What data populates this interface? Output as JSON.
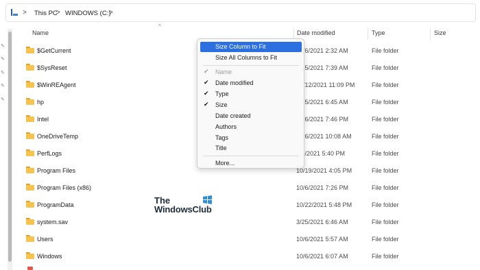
{
  "address_bar": {
    "segments": [
      "This PC",
      "WINDOWS (C:)"
    ],
    "separator": ">",
    "icon": "monitor-icon"
  },
  "columns": {
    "name": "Name",
    "date_modified": "Date modified",
    "type": "Type",
    "size": "Size",
    "sort_indicator": "^"
  },
  "files": [
    {
      "name": "$GetCurrent",
      "date": "10/6/2021 2:32 AM",
      "type": "File folder"
    },
    {
      "name": "$SysReset",
      "date": "3/25/2021 7:39 AM",
      "type": "File folder"
    },
    {
      "name": "$WinREAgent",
      "date": "10/12/2021 11:09 PM",
      "type": "File folder"
    },
    {
      "name": "hp",
      "date": "3/25/2021 6:45 AM",
      "type": "File folder"
    },
    {
      "name": "Intel",
      "date": "3/26/2021 7:46 PM",
      "type": "File folder"
    },
    {
      "name": "OneDriveTemp",
      "date": "3/26/2021 10:08 AM",
      "type": "File folder"
    },
    {
      "name": "PerfLogs",
      "date": "6/5/2021 5:40 PM",
      "type": "File folder"
    },
    {
      "name": "Program Files",
      "date": "10/19/2021 4:05 PM",
      "type": "File folder"
    },
    {
      "name": "Program Files (x86)",
      "date": "10/6/2021 7:26 PM",
      "type": "File folder"
    },
    {
      "name": "ProgramData",
      "date": "10/22/2021 5:48 PM",
      "type": "File folder"
    },
    {
      "name": "system.sav",
      "date": "3/25/2021 6:46 AM",
      "type": "File folder"
    },
    {
      "name": "Users",
      "date": "10/6/2021 5:57 AM",
      "type": "File folder"
    },
    {
      "name": "Windows",
      "date": "10/6/2021 6:07 AM",
      "type": "File folder"
    }
  ],
  "context_menu": {
    "size_column_to_fit": "Size Column to Fit",
    "size_all_columns_to_fit": "Size All Columns to Fit",
    "items": [
      {
        "label": "Name",
        "checked": true,
        "disabled": true
      },
      {
        "label": "Date modified",
        "checked": true,
        "disabled": false
      },
      {
        "label": "Type",
        "checked": true,
        "disabled": false
      },
      {
        "label": "Size",
        "checked": true,
        "disabled": false
      },
      {
        "label": "Date created",
        "checked": false,
        "disabled": false
      },
      {
        "label": "Authors",
        "checked": false,
        "disabled": false
      },
      {
        "label": "Tags",
        "checked": false,
        "disabled": false
      },
      {
        "label": "Title",
        "checked": false,
        "disabled": false
      }
    ],
    "more": "More...",
    "check_glyph": "✔"
  },
  "watermark": {
    "line1": "The",
    "line2": "WindowsClub"
  },
  "colors": {
    "highlight": "#2b6fe0",
    "folder": "#f6c44e",
    "folder_tab": "#dca02c",
    "logo": "#2e8fd6"
  }
}
